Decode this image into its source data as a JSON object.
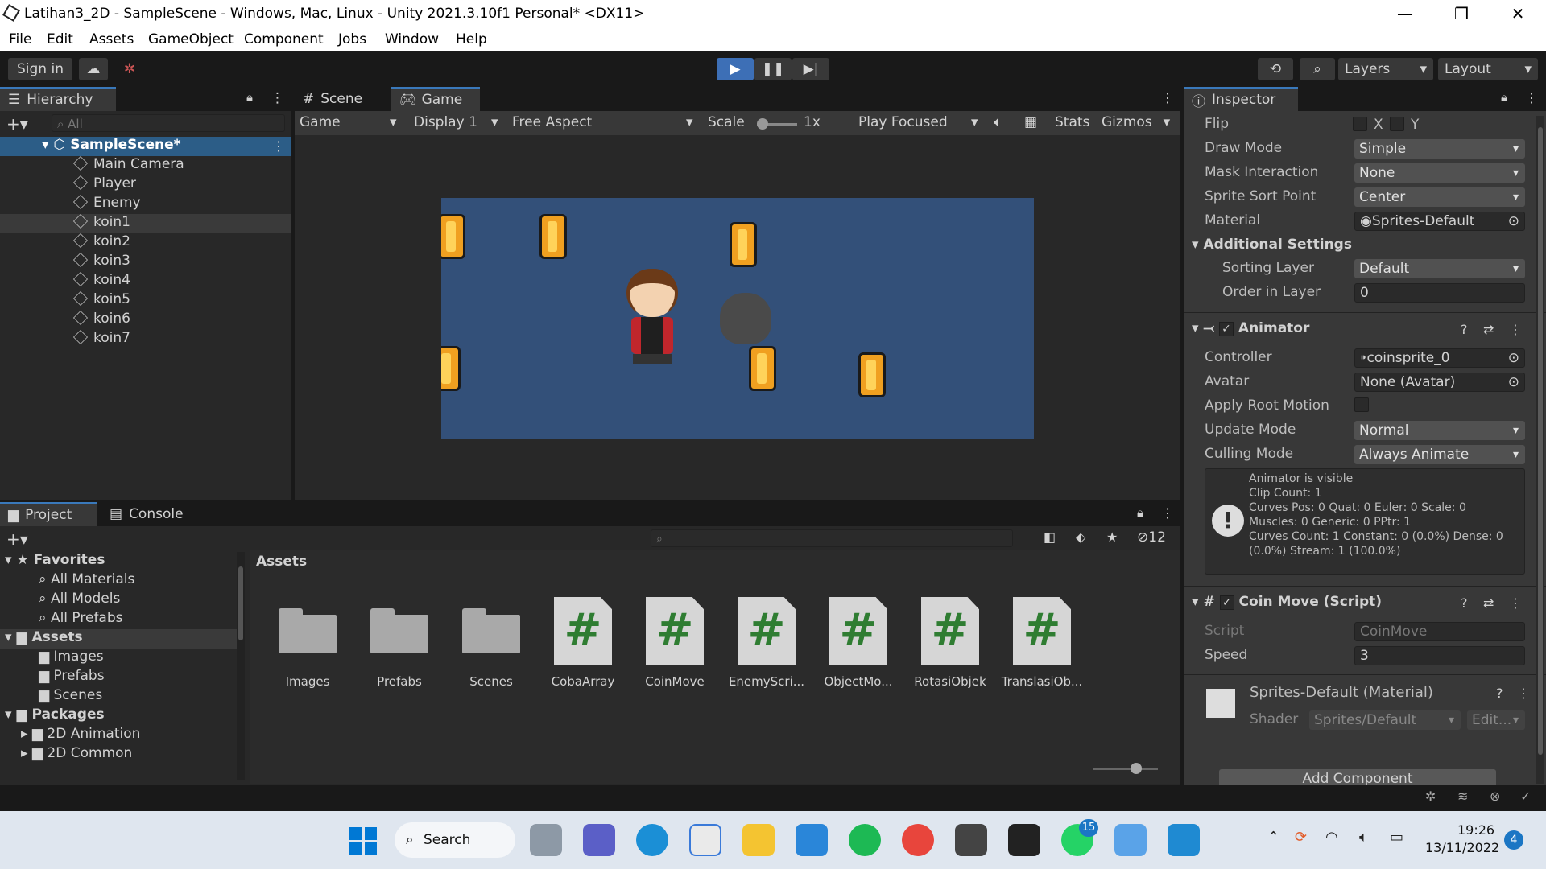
{
  "window": {
    "title": "Latihan3_2D - SampleScene - Windows, Mac, Linux - Unity 2021.3.10f1 Personal* <DX11>"
  },
  "menu": [
    "File",
    "Edit",
    "Assets",
    "GameObject",
    "Component",
    "Jobs",
    "Window",
    "Help"
  ],
  "toolbar": {
    "sign_in": "Sign in",
    "layers": "Layers",
    "layout": "Layout"
  },
  "hierarchy": {
    "tab": "Hierarchy",
    "search_placeholder": "All",
    "scene": "SampleScene*",
    "items": [
      "Main Camera",
      "Player",
      "Enemy",
      "koin1",
      "koin2",
      "koin3",
      "koin4",
      "koin5",
      "koin6",
      "koin7"
    ]
  },
  "game_view": {
    "tabs": [
      "Scene",
      "Game"
    ],
    "mode": "Game",
    "display": "Display 1",
    "aspect": "Free Aspect",
    "scale_label": "Scale",
    "scale_value": "1x",
    "play_mode": "Play Focused",
    "stats": "Stats",
    "gizmos": "Gizmos"
  },
  "project": {
    "tabs": [
      "Project",
      "Console"
    ],
    "badge_count": "12",
    "favorites_label": "Favorites",
    "favorites": [
      "All Materials",
      "All Models",
      "All Prefabs"
    ],
    "assets_label": "Assets",
    "asset_folders_tree": [
      "Images",
      "Prefabs",
      "Scenes"
    ],
    "packages_label": "Packages",
    "packages": [
      "2D Animation",
      "2D Common"
    ],
    "breadcrumb": "Assets",
    "grid": [
      {
        "name": "Images",
        "kind": "folder"
      },
      {
        "name": "Prefabs",
        "kind": "folder"
      },
      {
        "name": "Scenes",
        "kind": "folder"
      },
      {
        "name": "CobaArray",
        "kind": "script"
      },
      {
        "name": "CoinMove",
        "kind": "script"
      },
      {
        "name": "EnemyScri...",
        "kind": "script"
      },
      {
        "name": "ObjectMo...",
        "kind": "script"
      },
      {
        "name": "RotasiObjek",
        "kind": "script"
      },
      {
        "name": "TranslasiOb...",
        "kind": "script"
      }
    ]
  },
  "inspector": {
    "tab": "Inspector",
    "flip_label": "Flip",
    "flip_x": "X",
    "flip_y": "Y",
    "draw_mode_label": "Draw Mode",
    "draw_mode": "Simple",
    "mask_label": "Mask Interaction",
    "mask": "None",
    "sort_point_label": "Sprite Sort Point",
    "sort_point": "Center",
    "material_label": "Material",
    "material": "Sprites-Default",
    "additional_settings": "Additional Settings",
    "sorting_layer_label": "Sorting Layer",
    "sorting_layer": "Default",
    "order_label": "Order in Layer",
    "order": "0",
    "animator_title": "Animator",
    "controller_label": "Controller",
    "controller": "coinsprite_0",
    "avatar_label": "Avatar",
    "avatar": "None (Avatar)",
    "root_motion_label": "Apply Root Motion",
    "update_mode_label": "Update Mode",
    "update_mode": "Normal",
    "culling_label": "Culling Mode",
    "culling": "Always Animate",
    "info_lines": [
      "Animator is visible",
      "Clip Count: 1",
      "Curves Pos: 0 Quat: 0 Euler: 0 Scale: 0",
      "Muscles: 0 Generic: 0 PPtr: 1",
      "Curves Count: 1 Constant: 0 (0.0%) Dense: 0",
      "(0.0%) Stream: 1 (100.0%)"
    ],
    "coin_move_title": "Coin Move (Script)",
    "script_label": "Script",
    "script": "CoinMove",
    "speed_label": "Speed",
    "speed": "3",
    "material_title": "Sprites-Default (Material)",
    "shader_label": "Shader",
    "shader": "Sprites/Default",
    "edit": "Edit...",
    "add_component": "Add Component"
  },
  "taskbar": {
    "search": "Search",
    "time": "19:26",
    "date": "13/11/2022",
    "whatsapp_badge": "15",
    "notif_count": "4"
  }
}
